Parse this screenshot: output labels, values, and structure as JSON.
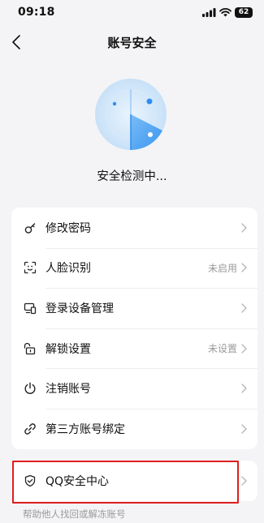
{
  "status_bar": {
    "time": "09:18",
    "battery": "62"
  },
  "nav": {
    "title": "账号安全"
  },
  "scan": {
    "status_text": "安全检测中..."
  },
  "menu": [
    {
      "label": "修改密码",
      "value": "",
      "icon": "key-icon"
    },
    {
      "label": "人脸识别",
      "value": "未启用",
      "icon": "face-scan-icon"
    },
    {
      "label": "登录设备管理",
      "value": "",
      "icon": "devices-icon"
    },
    {
      "label": "解锁设置",
      "value": "未设置",
      "icon": "unlock-icon"
    },
    {
      "label": "注销账号",
      "value": "",
      "icon": "power-icon"
    },
    {
      "label": "第三方账号绑定",
      "value": "",
      "icon": "link-icon"
    }
  ],
  "qq_security": {
    "label": "QQ安全中心",
    "icon": "shield-check-icon",
    "help_text": "帮助他人找回或解冻账号"
  },
  "colors": {
    "accent": "#2b8ef0",
    "highlight": "#e01e1e",
    "background": "#f4f4f6"
  }
}
